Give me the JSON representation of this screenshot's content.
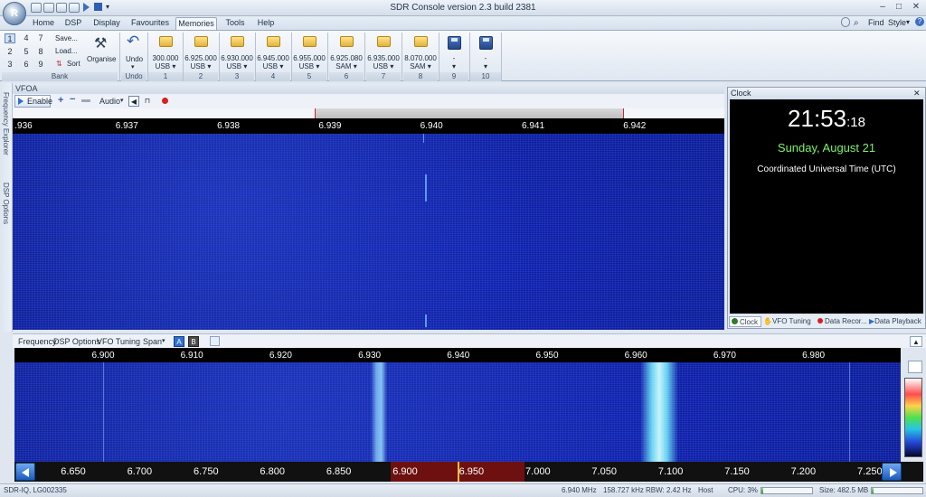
{
  "window": {
    "title": "SDR Console version 2.3 build 2381"
  },
  "tabs": [
    "Home",
    "DSP",
    "Display",
    "Favourites",
    "Memories",
    "Tools",
    "Help"
  ],
  "active_tab": "Memories",
  "right_tools": {
    "find": "Find",
    "style": "Style"
  },
  "bank": {
    "keys": [
      "1",
      "4",
      "7",
      "2",
      "5",
      "8",
      "3",
      "6",
      "9"
    ],
    "selected": "1",
    "save": "Save...",
    "load": "Load...",
    "sort": "Sort",
    "label": "Bank"
  },
  "organise": {
    "label": "Organise"
  },
  "undo": {
    "label": "Undo",
    "group": "Undo"
  },
  "memories": [
    {
      "value": "300.000",
      "mode": "USB",
      "slot": "1"
    },
    {
      "value": "6.925.000",
      "mode": "USB",
      "slot": "2"
    },
    {
      "value": "6.930.000",
      "mode": "USB",
      "slot": "3"
    },
    {
      "value": "6.945.000",
      "mode": "USB",
      "slot": "4"
    },
    {
      "value": "6.955.000",
      "mode": "USB",
      "slot": "5"
    },
    {
      "value": "6.925.080",
      "mode": "SAM",
      "slot": "6"
    },
    {
      "value": "6.935.000",
      "mode": "USB",
      "slot": "7"
    },
    {
      "value": "8.070.000",
      "mode": "SAM",
      "slot": "8"
    },
    {
      "value": "-",
      "mode": "",
      "slot": "9"
    },
    {
      "value": "-",
      "mode": "",
      "slot": "10"
    }
  ],
  "sidebar": {
    "item1": "Frequency Explorer",
    "item2": "DSP Options"
  },
  "vfo": {
    "title": "VFOA",
    "enable": "Enable",
    "audio": "Audio",
    "scale": [
      {
        "label": ".936",
        "pos": 0.0
      },
      {
        "label": "6.937",
        "pos": 0.143
      },
      {
        "label": "6.938",
        "pos": 0.287
      },
      {
        "label": "6.939",
        "pos": 0.43
      },
      {
        "label": "6.940",
        "pos": 0.573
      },
      {
        "label": "6.941",
        "pos": 0.717
      },
      {
        "label": "6.942",
        "pos": 0.86
      }
    ]
  },
  "clock": {
    "title": "Clock",
    "time": "21:53",
    "seconds": ":18",
    "date": "Sunday, August 21",
    "zone": "Coordinated Universal Time (UTC)",
    "tabs": [
      "Clock",
      "VFO Tuning",
      "Data Recor...",
      "Data Playback"
    ]
  },
  "spectrum": {
    "toolbar": {
      "frequency": "Frequency",
      "dsp": "DSP Options",
      "tuning": "VFO Tuning",
      "span": "Span",
      "a": "A",
      "b": "B"
    },
    "scale": [
      "6.900",
      "6.910",
      "6.920",
      "6.930",
      "6.940",
      "6.950",
      "6.960",
      "6.970",
      "6.980"
    ],
    "band": [
      "6.650",
      "6.700",
      "6.750",
      "6.800",
      "6.850",
      "6.900",
      "6.950",
      "7.000",
      "7.050",
      "7.100",
      "7.150",
      "7.200",
      "7.250"
    ]
  },
  "status": {
    "device": "SDR-IQ, LG002335",
    "freq": "6.940 MHz",
    "khz": "158.727 kHz",
    "rbw": "RBW: 2.42 Hz",
    "host": "Host",
    "cpu": "CPU: 3%",
    "cpu_level": 0.03,
    "size": "Size: 482.5 MB"
  }
}
